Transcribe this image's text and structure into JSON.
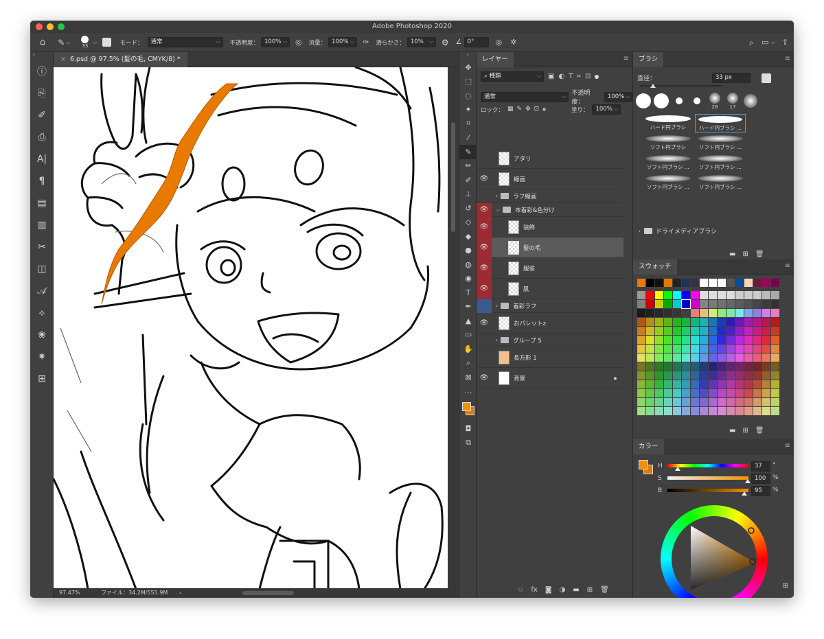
{
  "window": {
    "title": "Adobe Photoshop 2020"
  },
  "options": {
    "brush_size": "33",
    "mode_label": "モード：",
    "mode_value": "通常",
    "opacity_label": "不透明度：",
    "opacity_value": "100%",
    "flow_label": "流量：",
    "flow_value": "100%",
    "smooth_label": "滑らかさ：",
    "smooth_value": "10%",
    "angle_value": "0°"
  },
  "document": {
    "tab_title": "6.psd @ 97.5% (髪の毛, CMYK/8) *"
  },
  "status": {
    "zoom": "97.47%",
    "file_info": "ファイル：34.2M/555.9M"
  },
  "layers_panel": {
    "tab": "レイヤー",
    "filter_kind": "種類",
    "blend_mode": "通常",
    "opacity_label": "不透明度：",
    "opacity_value": "100%",
    "lock_label": "ロック：",
    "fill_label": "塗り：",
    "fill_value": "100%",
    "layers": [
      {
        "name": "アタリ",
        "visible": false,
        "type": "layer",
        "indent": 0,
        "color": ""
      },
      {
        "name": "線画",
        "visible": true,
        "type": "layer",
        "indent": 0,
        "color": ""
      },
      {
        "name": "ラフ線画",
        "visible": false,
        "type": "group",
        "indent": 0,
        "color": ""
      },
      {
        "name": "本着彩&色分け",
        "visible": true,
        "type": "group-open",
        "indent": 0,
        "color": "#9c2b32"
      },
      {
        "name": "装飾",
        "visible": true,
        "type": "layer",
        "indent": 1,
        "color": "#9c2b32"
      },
      {
        "name": "髪の毛",
        "visible": true,
        "type": "layer",
        "indent": 1,
        "color": "#9c2b32",
        "selected": true
      },
      {
        "name": "服装",
        "visible": true,
        "type": "layer",
        "indent": 1,
        "color": "#9c2b32"
      },
      {
        "name": "肌",
        "visible": true,
        "type": "layer",
        "indent": 1,
        "color": "#9c2b32"
      },
      {
        "name": "着彩ラフ",
        "visible": false,
        "type": "group",
        "indent": 0,
        "color": "#3c5b8c"
      },
      {
        "name": "おパレットz",
        "visible": true,
        "type": "layer",
        "indent": 0,
        "color": ""
      },
      {
        "name": "グループ 5",
        "visible": false,
        "type": "group",
        "indent": 0,
        "color": ""
      },
      {
        "name": "長方形 1",
        "visible": false,
        "type": "shape",
        "indent": 0,
        "color": ""
      },
      {
        "name": "背景",
        "visible": true,
        "type": "background",
        "indent": 0,
        "color": ""
      }
    ]
  },
  "brush_panel": {
    "tab": "ブラシ",
    "size_label": "直径：",
    "size_value": "33 px",
    "preset_sizes": [
      "",
      "",
      "",
      "",
      "28",
      "17",
      ""
    ],
    "presets": [
      "ハード円ブラシ",
      "ハード円ブラシ ...",
      "ソフト円ブラシ",
      "ソフト円ブラシ ...",
      "ソフト円ブラシ ...",
      "ソフト円ブラシ ...",
      "ソフト円ブラシ ...",
      "ソフト円ブラシ ..."
    ],
    "group": "ドライメディアブラシ"
  },
  "swatches_panel": {
    "tab": "スウォッチ"
  },
  "color_panel": {
    "tab": "カラー",
    "h_label": "H",
    "h_value": "37",
    "h_unit": "°",
    "s_label": "S",
    "s_value": "100",
    "s_unit": "%",
    "b_label": "B",
    "b_value": "95",
    "b_unit": "%",
    "fg_color": "#f29000",
    "bg_color": "#e07a00"
  },
  "accent": {
    "orange": "#e87a00",
    "layer_red": "#9c2b32",
    "layer_blue": "#3c5b8c",
    "select_blue": "#4a9de0"
  }
}
